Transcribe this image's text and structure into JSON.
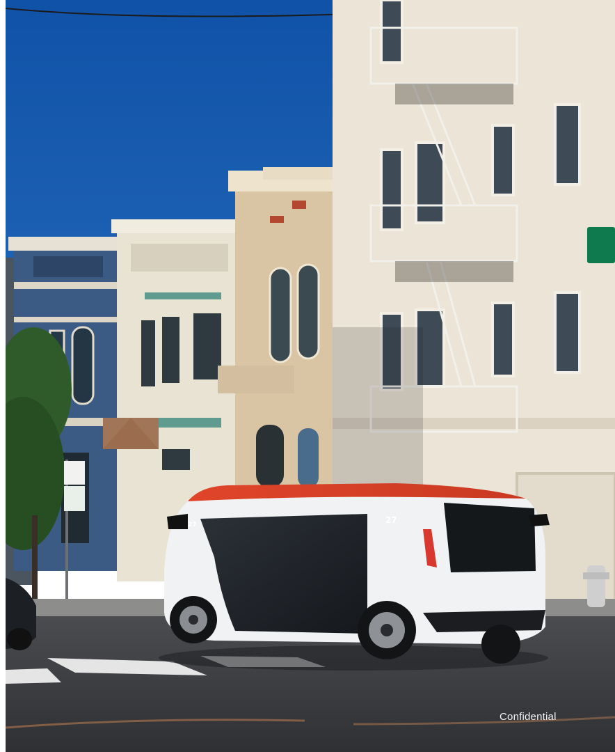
{
  "watermark": {
    "text": "Confidential"
  },
  "vehicle": {
    "number": "27"
  },
  "colors": {
    "sky": "#1a5fae",
    "building_cream": "#ece4d6",
    "vehicle_roof": "#e24a2e",
    "vehicle_body": "#f1f2f4",
    "street_sign": "#0e7a4e",
    "road": "#3a3c40"
  }
}
